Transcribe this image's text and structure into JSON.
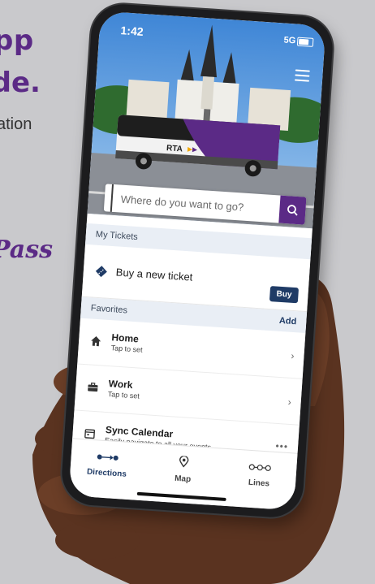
{
  "promo": {
    "line1": "pp",
    "line2": "ide.",
    "line3": "ation",
    "script": "Pass"
  },
  "status": {
    "time": "1:42",
    "network": "5G"
  },
  "hero": {
    "bus_brand": "RTA"
  },
  "search": {
    "placeholder": "Where do you want to go?"
  },
  "tickets": {
    "section_title": "My Tickets",
    "buy_new_label": "Buy a new ticket",
    "buy_button": "Buy"
  },
  "favorites": {
    "section_title": "Favorites",
    "add_label": "Add",
    "items": [
      {
        "title": "Home",
        "subtitle": "Tap to set",
        "icon": "home-icon"
      },
      {
        "title": "Work",
        "subtitle": "Tap to set",
        "icon": "briefcase-icon"
      },
      {
        "title": "Sync Calendar",
        "subtitle": "Easily navigate to all your events",
        "icon": "calendar-icon"
      }
    ]
  },
  "nav": {
    "items": [
      {
        "label": "Directions",
        "icon": "directions-icon"
      },
      {
        "label": "Map",
        "icon": "map-pin-icon"
      },
      {
        "label": "Lines",
        "icon": "lines-icon"
      }
    ]
  },
  "colors": {
    "brand_purple": "#5b2a86",
    "navy": "#1f3b66",
    "section_bg": "#e9eef5"
  }
}
